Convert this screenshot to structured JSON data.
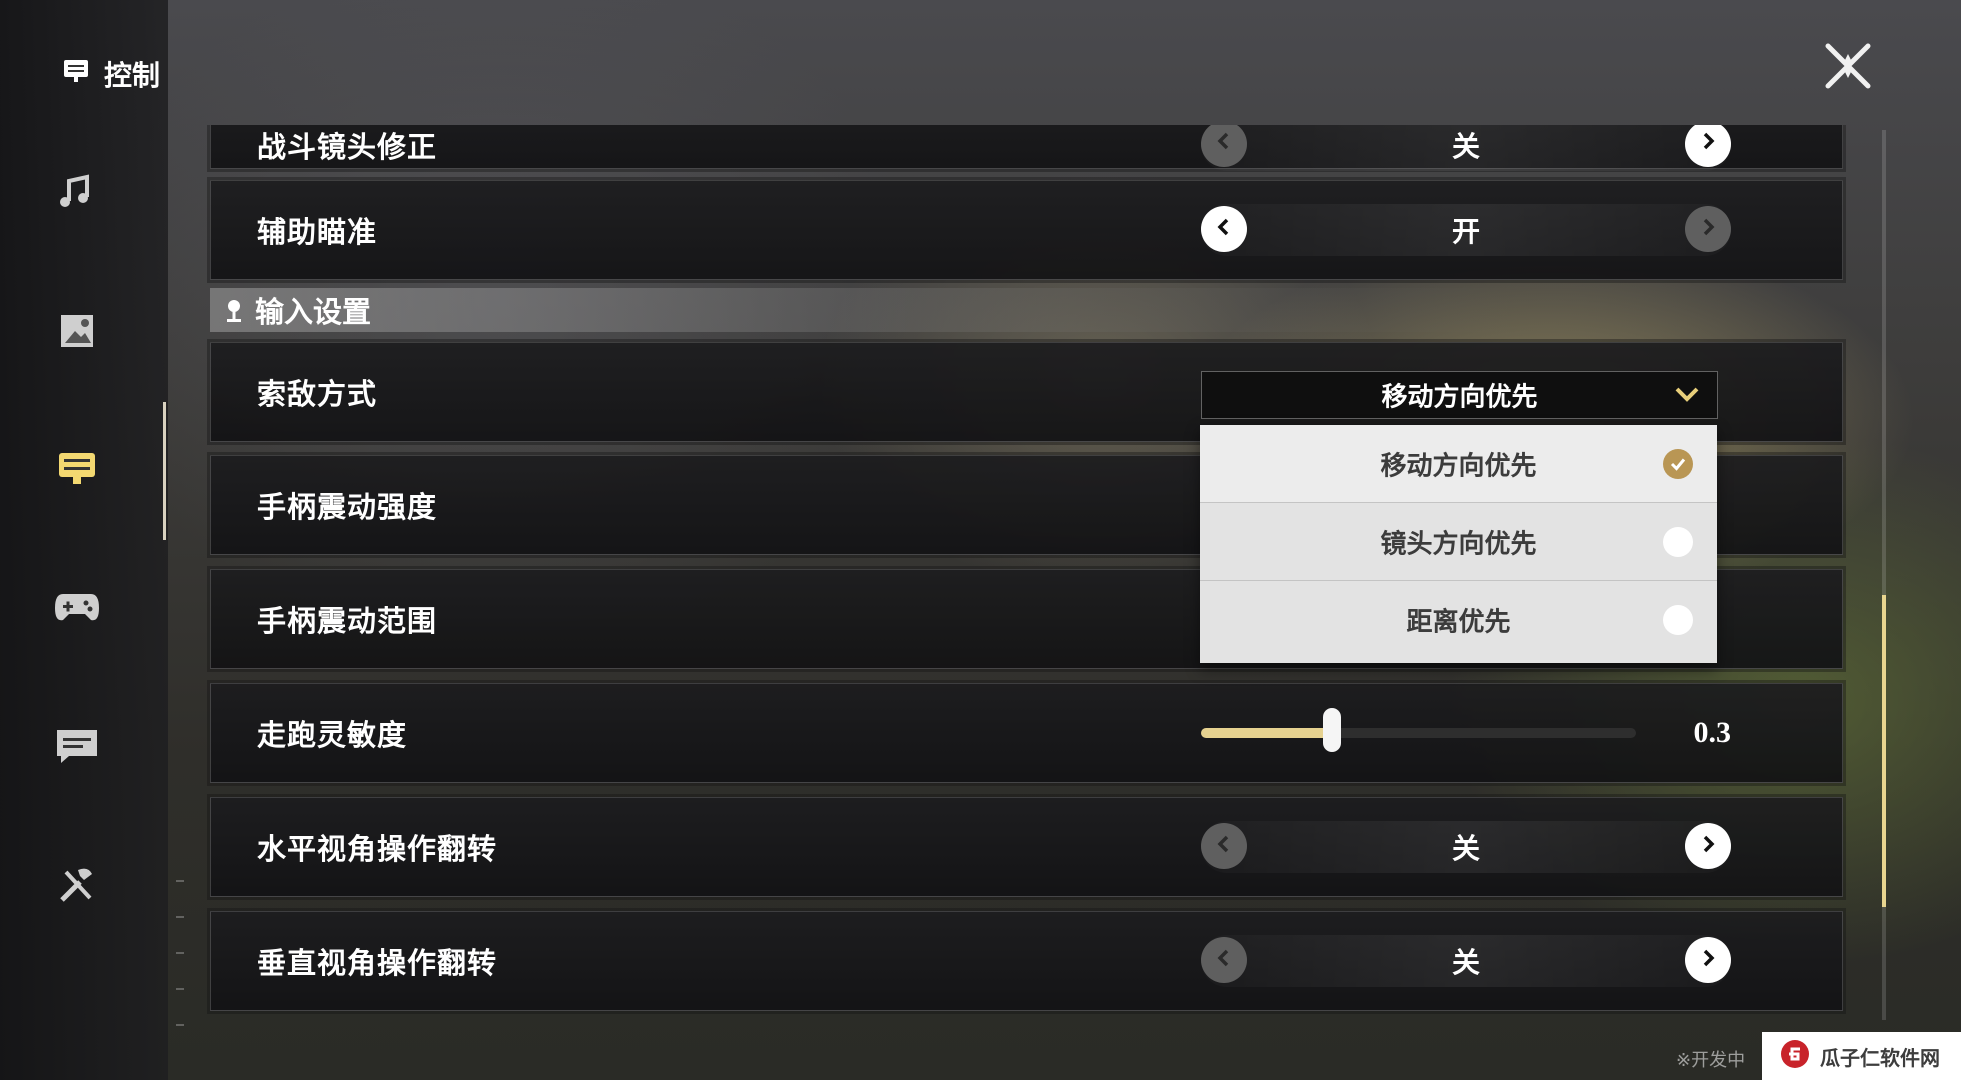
{
  "sidebar": {
    "title": "控制",
    "items": [
      {
        "name": "audio",
        "icon": "music-note-icon"
      },
      {
        "name": "graphics",
        "icon": "image-icon"
      },
      {
        "name": "controls",
        "icon": "controls-icon",
        "active": true
      },
      {
        "name": "gamepad",
        "icon": "gamepad-icon"
      },
      {
        "name": "chat",
        "icon": "chat-icon"
      },
      {
        "name": "other",
        "icon": "tools-icon"
      }
    ]
  },
  "header": {
    "close_icon": "close-icon"
  },
  "rows": {
    "camera_correction": {
      "label": "战斗镜头修正",
      "value": "关"
    },
    "aim_assist": {
      "label": "辅助瞄准",
      "value": "开"
    },
    "input_section": {
      "title": "输入设置",
      "icon": "pin-icon"
    },
    "targeting_mode": {
      "label": "索敌方式",
      "value": "移动方向优先",
      "options": [
        {
          "label": "移动方向优先",
          "selected": true
        },
        {
          "label": "镜头方向优先",
          "selected": false
        },
        {
          "label": "距离优先",
          "selected": false
        }
      ]
    },
    "vibration_strength": {
      "label": "手柄震动强度"
    },
    "vibration_range": {
      "label": "手柄震动范围"
    },
    "run_sensitivity": {
      "label": "走跑灵敏度",
      "value": "0.3",
      "fraction": 0.3
    },
    "invert_horizontal": {
      "label": "水平视角操作翻转",
      "value": "关"
    },
    "invert_vertical": {
      "label": "垂直视角操作翻转",
      "value": "关"
    }
  },
  "scrollbar": {
    "position_fraction": 0.68,
    "thumb_fraction": 0.35
  },
  "footer_note": "※开发中",
  "watermark": {
    "text": "瓜子仁软件网"
  },
  "colors": {
    "accent": "#e6d290",
    "selected_check": "#b99654",
    "menu_bg": "#e3e3e3"
  }
}
